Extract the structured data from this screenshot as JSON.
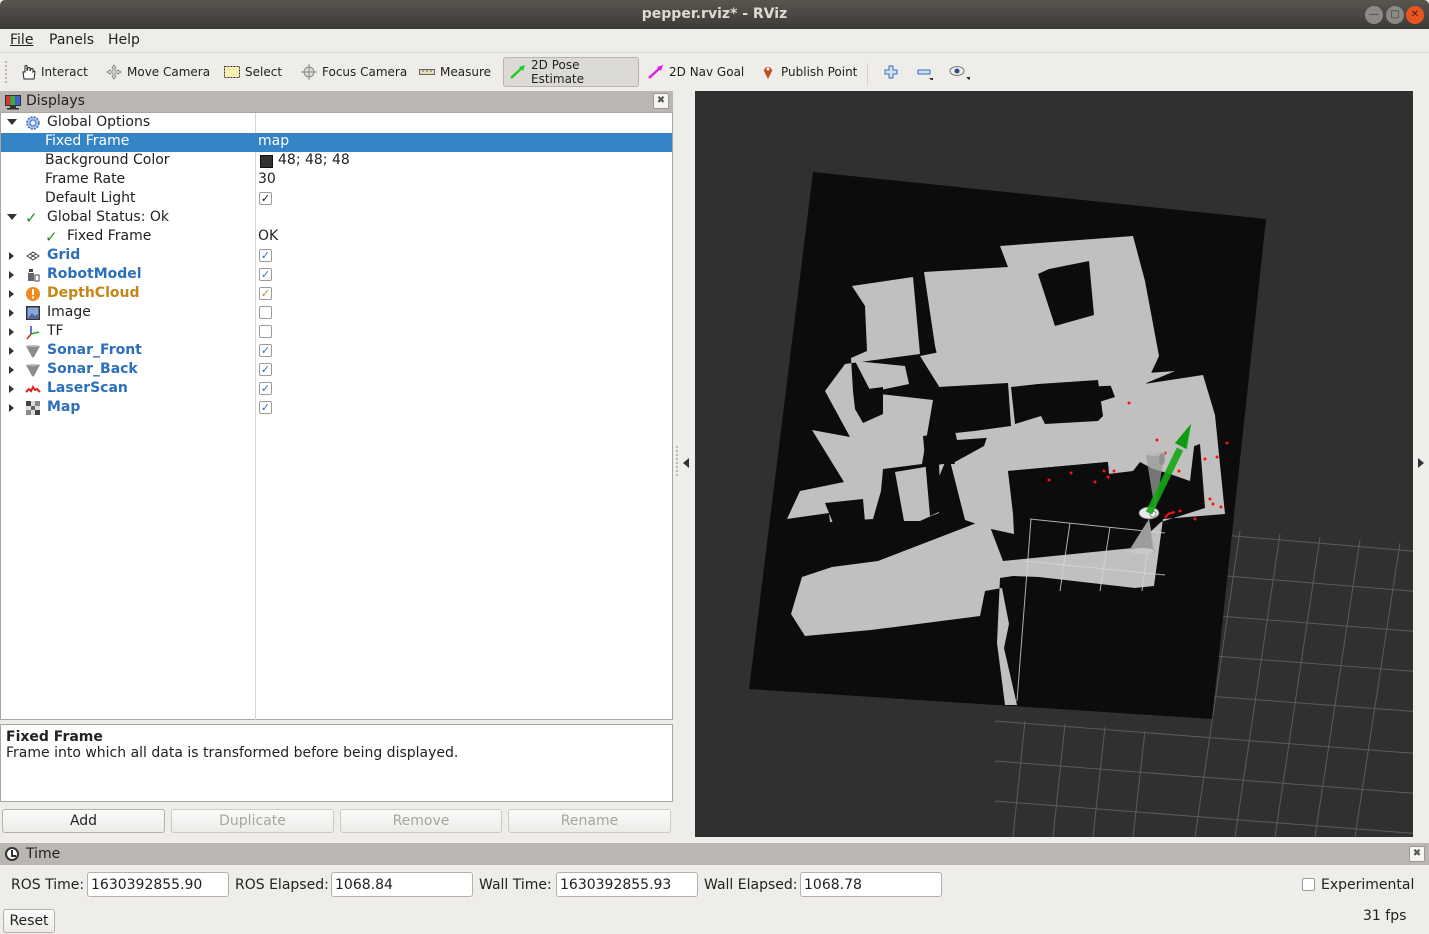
{
  "window": {
    "title": "pepper.rviz* - RViz",
    "controls": [
      "minimize",
      "maximize",
      "close"
    ]
  },
  "menubar": {
    "items": [
      {
        "label": "File",
        "mnemonic": "F"
      },
      {
        "label": "Panels",
        "mnemonic": "P"
      },
      {
        "label": "Help",
        "mnemonic": "H"
      }
    ]
  },
  "toolbar": {
    "tools": [
      {
        "label": "Interact",
        "icon": "hand-icon",
        "active": false
      },
      {
        "label": "Move Camera",
        "icon": "move-camera-icon",
        "active": false
      },
      {
        "label": "Select",
        "icon": "select-box-icon",
        "active": false
      },
      {
        "label": "Focus Camera",
        "icon": "focus-camera-icon",
        "active": false
      },
      {
        "label": "Measure",
        "icon": "ruler-icon",
        "active": false
      },
      {
        "label": "2D Pose Estimate",
        "icon": "green-arrow-icon",
        "active": true
      },
      {
        "label": "2D Nav Goal",
        "icon": "magenta-arrow-icon",
        "active": false
      },
      {
        "label": "Publish Point",
        "icon": "map-pin-icon",
        "active": false
      }
    ],
    "extra": [
      "add-tool-icon",
      "remove-tool-icon",
      "view-eye-icon"
    ]
  },
  "displays_panel": {
    "title": "Displays",
    "rows": [
      {
        "name": "Global Options",
        "value": "",
        "expanded": true,
        "level": 0,
        "icon": "gear-icon",
        "style": "normal"
      },
      {
        "name": "Fixed Frame",
        "value": "map",
        "level": 1,
        "selected": true,
        "style": "normal"
      },
      {
        "name": "Background Color",
        "value": "48; 48; 48",
        "level": 1,
        "swatch": "#303030",
        "style": "normal"
      },
      {
        "name": "Frame Rate",
        "value": "30",
        "level": 1,
        "style": "normal"
      },
      {
        "name": "Default Light",
        "checked": true,
        "level": 1,
        "style": "normal"
      },
      {
        "name": "Global Status: Ok",
        "value": "",
        "expanded": true,
        "level": 0,
        "icon": "checkmark-icon",
        "style": "normal"
      },
      {
        "name": "Fixed Frame",
        "value": "OK",
        "level": 1,
        "icon": "checkmark-icon",
        "style": "normal"
      },
      {
        "name": "Grid",
        "checked": true,
        "icon": "grid-icon",
        "style": "blue"
      },
      {
        "name": "RobotModel",
        "checked": true,
        "icon": "robot-icon",
        "style": "blue"
      },
      {
        "name": "DepthCloud",
        "checked": true,
        "icon": "warning-icon",
        "style": "orange"
      },
      {
        "name": "Image",
        "checked": false,
        "icon": "image-icon",
        "style": "normal"
      },
      {
        "name": "TF",
        "checked": false,
        "icon": "tf-axes-icon",
        "style": "normal"
      },
      {
        "name": "Sonar_Front",
        "checked": true,
        "icon": "cone-icon",
        "style": "blue"
      },
      {
        "name": "Sonar_Back",
        "checked": true,
        "icon": "cone-icon",
        "style": "blue"
      },
      {
        "name": "LaserScan",
        "checked": true,
        "icon": "laser-scan-icon",
        "style": "blue"
      },
      {
        "name": "Map",
        "checked": true,
        "icon": "map-icon",
        "style": "blue"
      }
    ],
    "description": {
      "title": "Fixed Frame",
      "text": "Frame into which all data is transformed before being displayed."
    },
    "buttons": [
      {
        "label": "Add",
        "enabled": true
      },
      {
        "label": "Duplicate",
        "enabled": false
      },
      {
        "label": "Remove",
        "enabled": false
      },
      {
        "label": "Rename",
        "enabled": false
      }
    ]
  },
  "viewport": {
    "background": "#303030",
    "map_free_color": "#c0c0c0",
    "map_unknown_color": "#0c0c0c",
    "pose_arrow_color": "#22cc22",
    "laser_color": "#ff0000"
  },
  "time_panel": {
    "title": "Time",
    "ros_time_label": "ROS Time:",
    "ros_time": "1630392855.90",
    "ros_elapsed_label": "ROS Elapsed:",
    "ros_elapsed": "1068.84",
    "wall_time_label": "Wall Time:",
    "wall_time": "1630392855.93",
    "wall_elapsed_label": "Wall Elapsed:",
    "wall_elapsed": "1068.78",
    "experimental_label": "Experimental",
    "experimental_checked": false,
    "reset_label": "Reset",
    "fps": "31 fps"
  }
}
